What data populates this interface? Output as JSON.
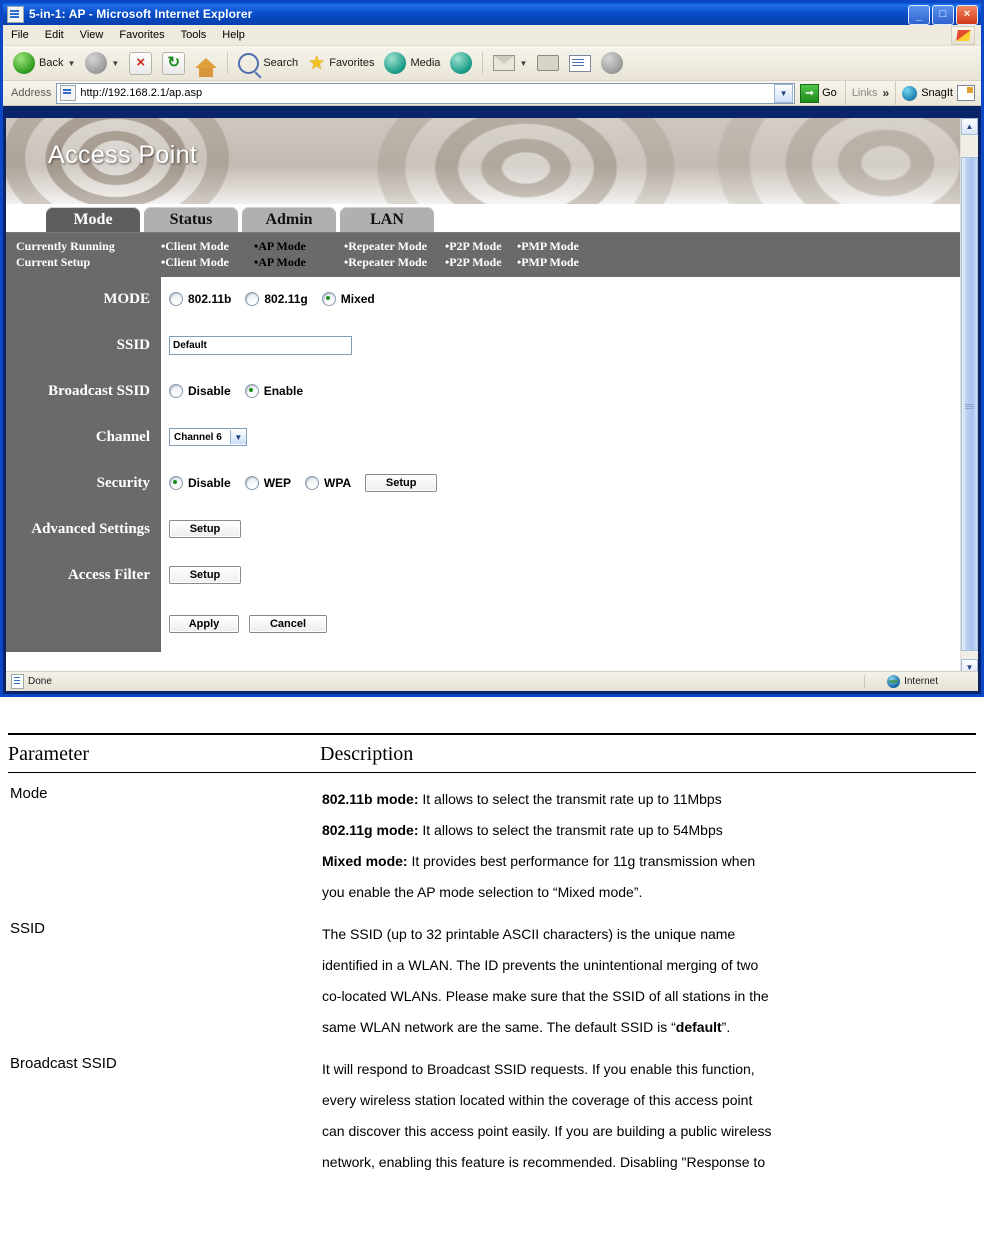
{
  "browser": {
    "title": "5-in-1: AP - Microsoft Internet Explorer",
    "menus": [
      "File",
      "Edit",
      "View",
      "Favorites",
      "Tools",
      "Help"
    ],
    "window_buttons": {
      "minimize": "_",
      "maximize": "□",
      "close": "×"
    },
    "toolbar": {
      "back": "Back",
      "forward": "",
      "stop": "",
      "refresh": "",
      "home": "",
      "search": "Search",
      "favorites": "Favorites",
      "media": "Media",
      "history": "",
      "mail": "",
      "print": "",
      "edit": "",
      "discuss": ""
    },
    "address": {
      "label": "Address",
      "url": "http://192.168.2.1/ap.asp",
      "go": "Go",
      "links": "Links",
      "overflow": "»",
      "snagit": "SnagIt"
    },
    "statusbar": {
      "message": "Done",
      "zone": "Internet"
    }
  },
  "app": {
    "banner_title": "Access Point",
    "tabs": [
      {
        "label": "Mode",
        "active": true
      },
      {
        "label": "Status",
        "active": false
      },
      {
        "label": "Admin",
        "active": false
      },
      {
        "label": "LAN",
        "active": false
      }
    ],
    "status_strip": {
      "rows": [
        {
          "label": "Currently Running",
          "modes": [
            {
              "text": "•Client Mode",
              "active": false
            },
            {
              "text": "•AP Mode",
              "active": true
            },
            {
              "text": "•Repeater Mode",
              "active": false
            },
            {
              "text": "•P2P Mode",
              "active": false
            },
            {
              "text": "•PMP Mode",
              "active": false
            }
          ]
        },
        {
          "label": "Current Setup",
          "modes": [
            {
              "text": "•Client Mode",
              "active": false
            },
            {
              "text": "•AP Mode",
              "active": true
            },
            {
              "text": "•Repeater Mode",
              "active": false
            },
            {
              "text": "•P2P Mode",
              "active": false
            },
            {
              "text": "•PMP Mode",
              "active": false
            }
          ]
        }
      ]
    },
    "form": {
      "mode": {
        "label": "MODE",
        "options": [
          {
            "label": "802.11b",
            "selected": false
          },
          {
            "label": "802.11g",
            "selected": false
          },
          {
            "label": "Mixed",
            "selected": true
          }
        ]
      },
      "ssid": {
        "label": "SSID",
        "value": "Default"
      },
      "broadcast_ssid": {
        "label": "Broadcast SSID",
        "options": [
          {
            "label": "Disable",
            "selected": false
          },
          {
            "label": "Enable",
            "selected": true
          }
        ]
      },
      "channel": {
        "label": "Channel",
        "value": "Channel 6"
      },
      "security": {
        "label": "Security",
        "options": [
          {
            "label": "Disable",
            "selected": true
          },
          {
            "label": "WEP",
            "selected": false
          },
          {
            "label": "WPA",
            "selected": false
          }
        ],
        "setup_label": "Setup"
      },
      "advanced_settings": {
        "label": "Advanced Settings",
        "setup_label": "Setup"
      },
      "access_filter": {
        "label": "Access Filter",
        "setup_label": "Setup"
      },
      "apply_label": "Apply",
      "cancel_label": "Cancel"
    },
    "colors": {
      "sidebar": "#6a6a6a",
      "tab_active": "#5e5e5e",
      "tab_inactive": "#b0b0b0",
      "radio_dot": "#1d8e1d"
    }
  },
  "doc": {
    "headers": {
      "parameter": "Parameter",
      "description": "Description"
    },
    "rows": [
      {
        "parameter": "Mode",
        "lines": [
          {
            "bold": "802.11b mode:",
            "text": " It allows to select the transmit rate up to 11Mbps"
          },
          {
            "bold": "802.11g mode:",
            "text": " It allows to select the transmit rate up to 54Mbps"
          },
          {
            "bold": "Mixed mode:",
            "text": " It provides best performance for 11g transmission when"
          },
          {
            "bold": "",
            "text": "you enable the AP mode selection to “Mixed mode”."
          }
        ]
      },
      {
        "parameter": "SSID",
        "lines": [
          {
            "bold": "",
            "text": "The SSID (up to 32 printable ASCII characters) is the unique name"
          },
          {
            "bold": "",
            "text": "identified in a WLAN. The ID prevents the unintentional merging of two"
          },
          {
            "bold": "",
            "text": "co-located WLANs. Please make sure that the SSID of all stations in the"
          },
          {
            "bold": "",
            "text": "same WLAN network are the same. The default SSID is “",
            "bold_tail": "default",
            "tail": "”."
          }
        ]
      },
      {
        "parameter": "Broadcast SSID",
        "lines": [
          {
            "bold": "",
            "text": "It will respond to Broadcast SSID requests. If you enable this function,"
          },
          {
            "bold": "",
            "text": "every wireless station located within the coverage of this access point"
          },
          {
            "bold": "",
            "text": "can discover this access point easily. If you are building a public wireless"
          },
          {
            "bold": "",
            "text": "network, enabling this feature is recommended. Disabling \"Response to"
          }
        ]
      }
    ]
  }
}
